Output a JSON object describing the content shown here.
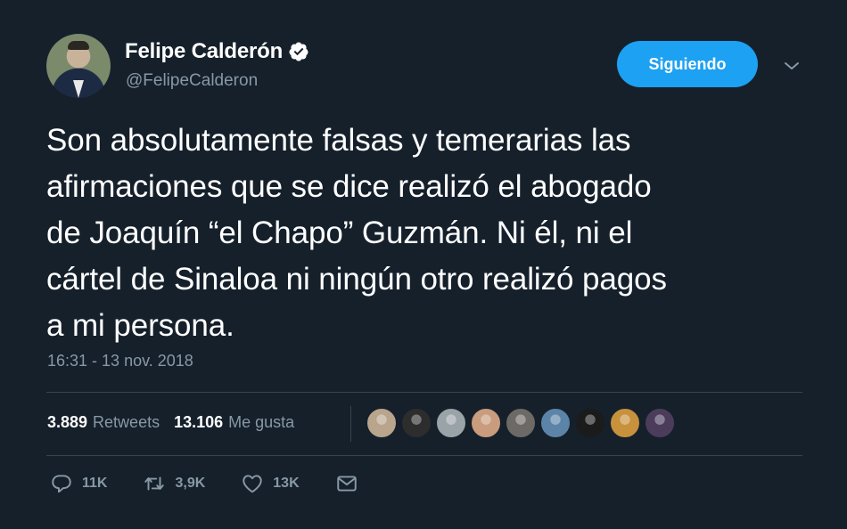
{
  "author": {
    "name": "Felipe Calderón",
    "handle": "@FelipeCalderon",
    "verified_icon": "verified-badge-icon",
    "avatar_icon": "avatar-photo"
  },
  "follow_button": {
    "label": "Siguiendo",
    "color": "#1da1f2"
  },
  "menu_icon": "chevron-down-icon",
  "tweet": {
    "lines": [
      "Son absolutamente falsas y temerarias las",
      "afirmaciones que se dice realizó el abogado",
      "de Joaquín “el Chapo” Guzmán. Ni él, ni el",
      "cártel de Sinaloa ni ningún otro realizó pagos",
      "a mi persona."
    ],
    "timestamp": "16:31 - 13 nov. 2018"
  },
  "stats": {
    "retweets_count": "3.889",
    "retweets_label": "Retweets",
    "likes_count": "13.106",
    "likes_label": "Me gusta"
  },
  "likers": [
    {
      "name": "liker-avatar-1",
      "color": "#b9a48c"
    },
    {
      "name": "liker-avatar-2",
      "color": "#2d2d2d"
    },
    {
      "name": "liker-avatar-3",
      "color": "#9aa3a8"
    },
    {
      "name": "liker-avatar-4",
      "color": "#c89c7c"
    },
    {
      "name": "liker-avatar-5",
      "color": "#6d6a66"
    },
    {
      "name": "liker-avatar-6",
      "color": "#5c84a8"
    },
    {
      "name": "liker-avatar-7",
      "color": "#1b1b1b"
    },
    {
      "name": "liker-avatar-8",
      "color": "#c8913c"
    },
    {
      "name": "liker-avatar-9",
      "color": "#4c3c5c"
    }
  ],
  "actions": {
    "reply_count": "11K",
    "retweet_count": "3,9K",
    "like_count": "13K"
  },
  "colors": {
    "background": "#15202b",
    "secondary_text": "#8899a6",
    "divider": "#38444d"
  }
}
